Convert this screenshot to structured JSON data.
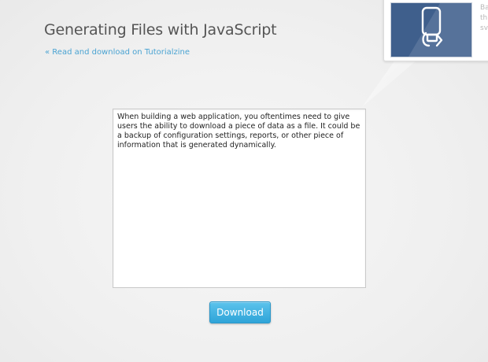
{
  "header": {
    "title": "Generating Files with JavaScript",
    "link_label": "« Read and download on Tutorialzine"
  },
  "promo": {
    "thumbnail_icon": "usb-drive-icon",
    "text_lines": [
      "Ba",
      "th",
      "sv"
    ]
  },
  "editor": {
    "value": "When building a web application, you oftentimes need to give users the ability to download a piece of data as a file. It could be a backup of configuration settings, reports, or other piece of information that is generated dynamically."
  },
  "actions": {
    "download_label": "Download"
  },
  "colors": {
    "accent": "#3aa8da",
    "link": "#4aa3d2",
    "title": "#555555",
    "thumbnail_bg": "#3f5f8c"
  }
}
